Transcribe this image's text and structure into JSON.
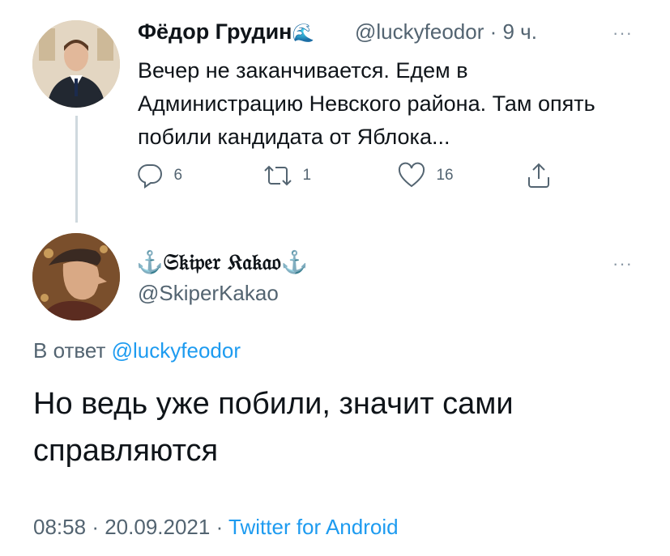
{
  "tweet1": {
    "author_name": "Фёдор Грудин",
    "author_emoji": "🌊",
    "handle": "@luckyfeodor",
    "separator": "·",
    "time_ago": "9 ч.",
    "more": "···",
    "text": "Вечер не заканчивается. Едем в Администрацию Невского района. Там опять побили кандидата от Яблока...",
    "replies": "6",
    "retweets": "1",
    "likes": "16"
  },
  "tweet2": {
    "author_name": "⚓𝔖𝔨𝔦𝔭𝔢𝔯 𝔎𝔞𝔨𝔞𝔬⚓",
    "handle": "@SkiperKakao",
    "more": "···",
    "reply_prefix": "В ответ",
    "reply_to": "@luckyfeodor",
    "text": "Но ведь уже побили, значит сами справляются",
    "time": "08:58",
    "sep": "·",
    "date": "20.09.2021",
    "source": "Twitter for Android"
  },
  "colors": {
    "text": "#0f1419",
    "secondary": "#536471",
    "link": "#1d9bf0",
    "thread_line": "#cfd9de"
  },
  "icons": [
    "reply-icon",
    "retweet-icon",
    "like-icon",
    "share-icon",
    "wave-emoji",
    "anchor-emoji",
    "more-icon"
  ]
}
